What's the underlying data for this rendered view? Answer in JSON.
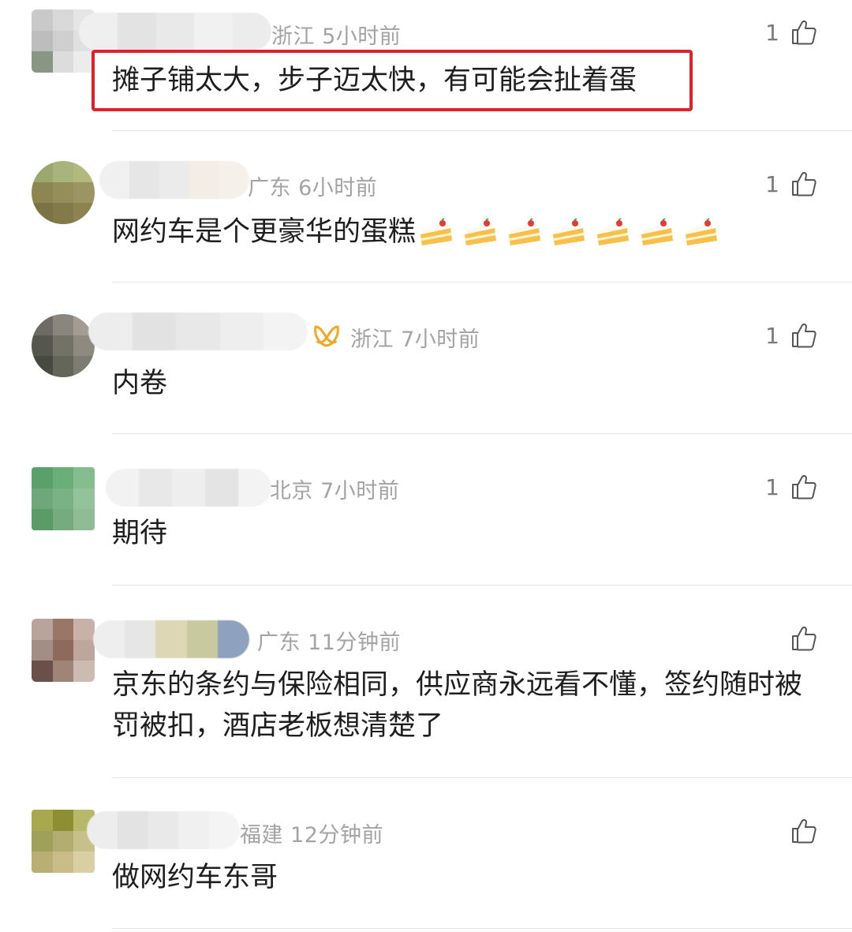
{
  "comments": [
    {
      "region": "浙江",
      "time": "5小时前",
      "likes": "1",
      "text": "摊子铺太大，步子迈太快，有可能会扯着蛋",
      "highlighted": true,
      "avatar_colors": [
        "#c9c9c9",
        "#d8d8d8",
        "#e5e5e5",
        "#bdbdbd",
        "#cfcfcf",
        "#e0e0e0",
        "#8a9684",
        "#dcdcdc",
        "#ececec"
      ],
      "name_colors": [
        "#efefef",
        "#e3e3e3",
        "#e9e9e9",
        "#f1f1f1",
        "#ececec"
      ]
    },
    {
      "region": "广东",
      "time": "6小时前",
      "likes": "1",
      "text": "网约车是个更豪华的蛋糕",
      "emoji_name": "cake-emoji",
      "emoji_count": 7,
      "avatar_colors": [
        "#9aa86e",
        "#a7b57c",
        "#b3b97d",
        "#8d8653",
        "#958d5a",
        "#9c9462",
        "#7c7344",
        "#837a4b",
        "#8c8351"
      ],
      "name_colors": [
        "#f0f0f0",
        "#e6e6e6",
        "#ebebeb",
        "#f4ede6",
        "#f5f0ea"
      ]
    },
    {
      "region": "浙江",
      "time": "7小时前",
      "likes": "1",
      "text": "内卷",
      "has_vip_badge": true,
      "vip_color": "#f5a623",
      "avatar_colors": [
        "#6f6a63",
        "#8a857d",
        "#a29c93",
        "#55574d",
        "#727266",
        "#8d8a80",
        "#474a40",
        "#65665a",
        "#7d7c70"
      ],
      "name_colors": [
        "#ededed",
        "#e2e2e2",
        "#e8e8e8",
        "#eeeeee",
        "#f3f3f3"
      ]
    },
    {
      "region": "北京",
      "time": "7小时前",
      "likes": "1",
      "text": "期待",
      "avatar_colors": [
        "#5aa06a",
        "#6aae78",
        "#86bd8f",
        "#6fa77a",
        "#7bb285",
        "#93c39a",
        "#5b9b68",
        "#76ab7f",
        "#8fbb95"
      ],
      "name_colors": [
        "#f2f2f2",
        "#e8e8e8",
        "#eeeeee",
        "#e4e4e4",
        "#f3f3f3"
      ]
    },
    {
      "region": "广东",
      "time": "11分钟前",
      "likes": "",
      "text": "京东的条约与保险相同，供应商永远看不懂，签约随时被罚被扣，酒店老板想清楚了",
      "avatar_colors": [
        "#b9a49b",
        "#9a7667",
        "#c8b2a7",
        "#a38e86",
        "#8e6a5c",
        "#bda69c",
        "#6a5049",
        "#a08478",
        "#cdbab1"
      ],
      "name_colors": [
        "#eeeeee",
        "#e6e6e6",
        "#ddd7b5",
        "#c9c9a0",
        "#8ea2bf"
      ]
    },
    {
      "region": "福建",
      "time": "12分钟前",
      "likes": "",
      "text": "做网约车东哥",
      "avatar_colors": [
        "#a7a94c",
        "#8d8f32",
        "#b8b86a",
        "#9fa05a",
        "#b2ad70",
        "#c8c08a",
        "#b9ae74",
        "#c9bc88",
        "#d9cfa3"
      ],
      "name_colors": [
        "#ededed",
        "#e3e3e3",
        "#e9e9e9",
        "#f0f0f0",
        "#f4f4f4"
      ]
    }
  ]
}
